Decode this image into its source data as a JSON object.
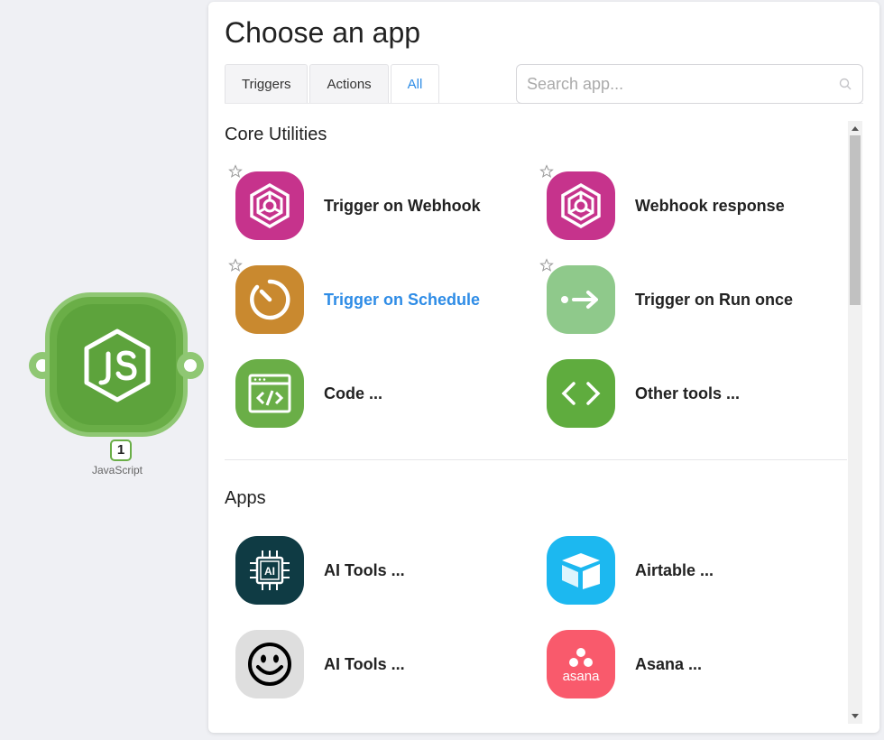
{
  "node": {
    "label": "JavaScript",
    "badge": "1",
    "color": "#6aae47"
  },
  "modal": {
    "title": "Choose an app",
    "tabs": [
      {
        "label": "Triggers",
        "active": false
      },
      {
        "label": "Actions",
        "active": false
      },
      {
        "label": "All",
        "active": true
      }
    ],
    "search": {
      "placeholder": "Search app...",
      "value": ""
    }
  },
  "sections": {
    "core": {
      "title": "Core Utilities",
      "items": [
        {
          "label": "Trigger on Webhook",
          "icon": "webhook-icon",
          "color": "#c6338c",
          "starred": false
        },
        {
          "label": "Webhook response",
          "icon": "webhook-icon",
          "color": "#c6338c",
          "starred": false
        },
        {
          "label": "Trigger on Schedule",
          "icon": "schedule-icon",
          "color": "#c9892f",
          "starred": false,
          "hover": true
        },
        {
          "label": "Trigger on Run once",
          "icon": "run-once-icon",
          "color": "#8fc98b",
          "starred": false
        },
        {
          "label": "Code ...",
          "icon": "code-window-icon",
          "color": "#6aae47"
        },
        {
          "label": "Other tools ...",
          "icon": "code-brackets-icon",
          "color": "#5fac3e"
        }
      ]
    },
    "apps": {
      "title": "Apps",
      "items": [
        {
          "label": "AI Tools ...",
          "icon": "ai-chip-icon",
          "color": "#0f3b44"
        },
        {
          "label": "Airtable ...",
          "icon": "airtable-icon",
          "color": "#1cb8f0"
        },
        {
          "label": "AI Tools ...",
          "icon": "smiley-icon",
          "color": "#dedede"
        },
        {
          "label": "Asana ...",
          "icon": "asana-icon",
          "color": "#f95a6c",
          "icon_text": "asana"
        }
      ]
    }
  },
  "colors": {
    "accent": "#2e8ce6",
    "background": "#eff0f4"
  }
}
